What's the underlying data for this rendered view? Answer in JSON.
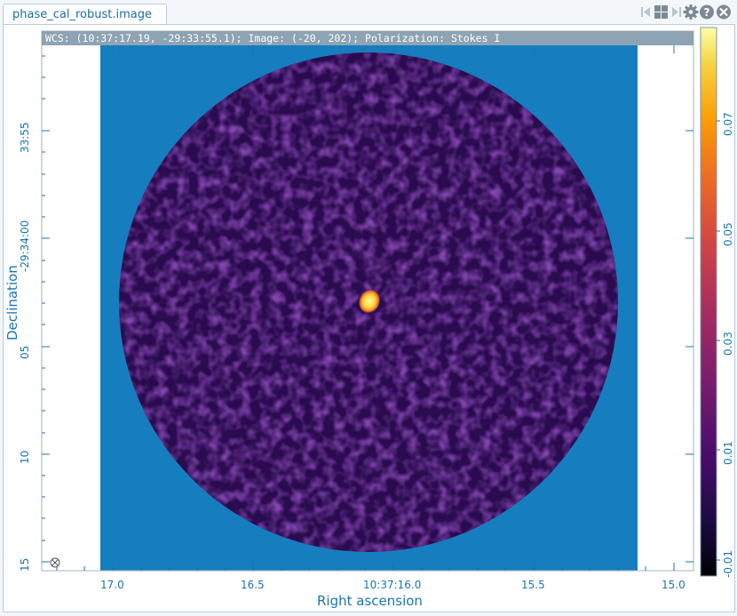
{
  "tab": {
    "title": "phase_cal_robust.image"
  },
  "toolbar": {
    "icons": [
      "step-back-icon",
      "grid-layout-icon",
      "step-forward-icon",
      "settings-gear-icon",
      "help-icon",
      "close-icon"
    ]
  },
  "wcs": {
    "readout": "WCS: (10:37:17.19, -29:33:55.1); Image: (-20, 202); Polarization: Stokes I"
  },
  "axes": {
    "xlabel": "Right ascension",
    "ylabel": "Declination",
    "xticks": [
      "17.0",
      "16.5",
      "10:37:16.0",
      "15.5",
      "15.0"
    ],
    "yticks": [
      "33:55",
      "-29:34:00",
      "05",
      "10",
      "15"
    ]
  },
  "colorbar": {
    "ticks": [
      "-0.01",
      "0.01",
      "0.03",
      "0.05",
      "0.07"
    ],
    "colormap": "inferno"
  },
  "colors": {
    "background_blue": "#167dbf",
    "map_dark": "#2e0c56",
    "accent": "#1b74b3"
  }
}
